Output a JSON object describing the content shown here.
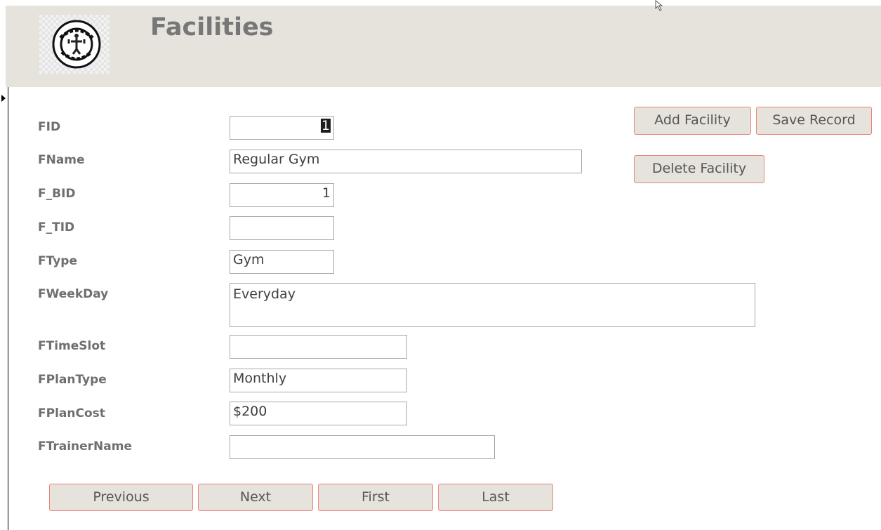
{
  "header": {
    "title": "Facilities",
    "logo_icon": "golds-gym-logo"
  },
  "form": {
    "fields": [
      {
        "label": "FID",
        "value": "1"
      },
      {
        "label": "FName",
        "value": "Regular Gym"
      },
      {
        "label": "F_BID",
        "value": "1"
      },
      {
        "label": "F_TID",
        "value": ""
      },
      {
        "label": "FType",
        "value": "Gym"
      },
      {
        "label": "FWeekDay",
        "value": "Everyday"
      },
      {
        "label": "FTimeSlot",
        "value": ""
      },
      {
        "label": "FPlanType",
        "value": "Monthly"
      },
      {
        "label": "FPlanCost",
        "value": "$200"
      },
      {
        "label": "FTrainerName",
        "value": ""
      }
    ]
  },
  "actions": {
    "add_facility": "Add Facility",
    "save_record": "Save Record",
    "delete_facility": "Delete Facility"
  },
  "navigation": {
    "previous": "Previous",
    "next": "Next",
    "first": "First",
    "last": "Last"
  },
  "colors": {
    "header_bg": "#e6e3dc",
    "button_border": "#e8857a",
    "label_text": "#6f6f6f",
    "title_text": "#777777"
  }
}
